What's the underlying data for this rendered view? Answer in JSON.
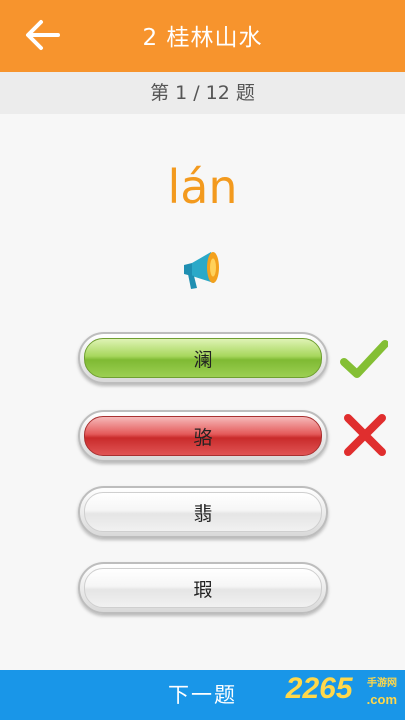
{
  "header": {
    "title": "2 桂林山水",
    "back_icon": "arrow-left-icon"
  },
  "progress": {
    "text": "第 1 / 12 题",
    "current": 1,
    "total": 12
  },
  "question": {
    "pinyin": "lán",
    "speaker_icon": "megaphone-icon"
  },
  "options": [
    {
      "label": "澜",
      "state": "correct",
      "mark_icon": "check-icon"
    },
    {
      "label": "骆",
      "state": "wrong",
      "mark_icon": "cross-icon"
    },
    {
      "label": "翡",
      "state": "normal"
    },
    {
      "label": "瑕",
      "state": "normal"
    }
  ],
  "footer": {
    "next_label": "下一题"
  },
  "watermark": {
    "number": "2265",
    "site_cn": "手游网",
    "site_suffix": ".com"
  },
  "colors": {
    "header": "#f7942d",
    "pinyin": "#f39a1e",
    "footer": "#1996e8",
    "correct": "#8cc63f",
    "wrong": "#e02e2e"
  }
}
